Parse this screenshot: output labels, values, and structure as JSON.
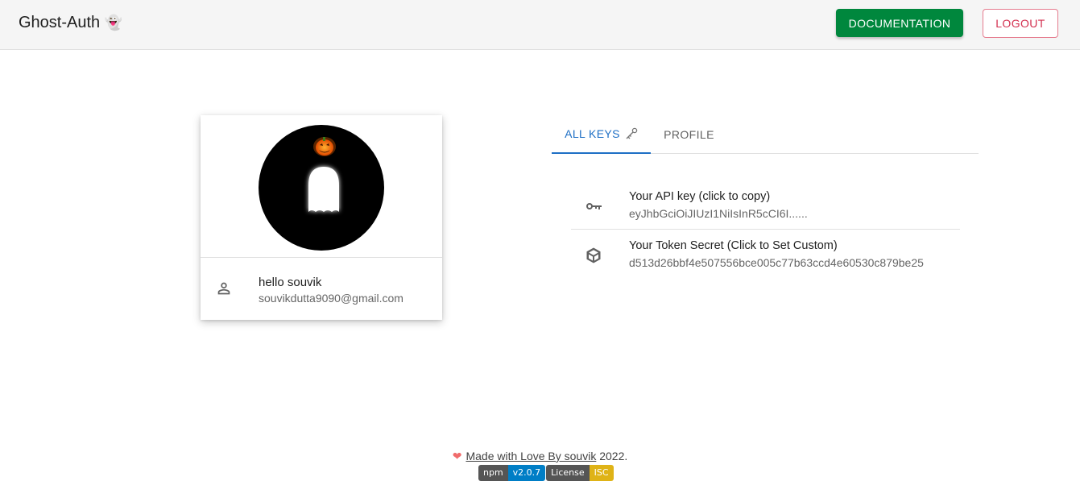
{
  "header": {
    "brand": "Ghost-Auth",
    "brand_icon": "ghost-emoji",
    "doc_button": "DOCUMENTATION",
    "logout_button": "LOGOUT",
    "colors": {
      "doc_bg": "#00873d",
      "logout_fg": "#d32f4f"
    }
  },
  "profile_card": {
    "greeting": "hello souvik",
    "email": "souvikdutta9090@gmail.com",
    "avatar": "ghost-with-pumpkin"
  },
  "tabs": [
    {
      "label": "ALL KEYS",
      "active": true,
      "icon": "key-icon"
    },
    {
      "label": "PROFILE",
      "active": false
    }
  ],
  "keys": [
    {
      "icon": "key-icon",
      "title": "Your API key (click to copy)",
      "value": "eyJhbGciOiJIUzI1NiIsInR5cCI6I......"
    },
    {
      "icon": "cube-icon",
      "title": "Your Token Secret (Click to Set Custom)",
      "value": "d513d26bbf4e507556bce005c77b63ccd4e60530c879be25"
    }
  ],
  "footer": {
    "link_text": "Made with Love By souvik",
    "year_text": " 2022.",
    "badges": [
      {
        "label": "npm",
        "value": "v2.0.7",
        "color": "#007ec6"
      },
      {
        "label": "License",
        "value": "ISC",
        "color": "#dfb317"
      }
    ]
  }
}
